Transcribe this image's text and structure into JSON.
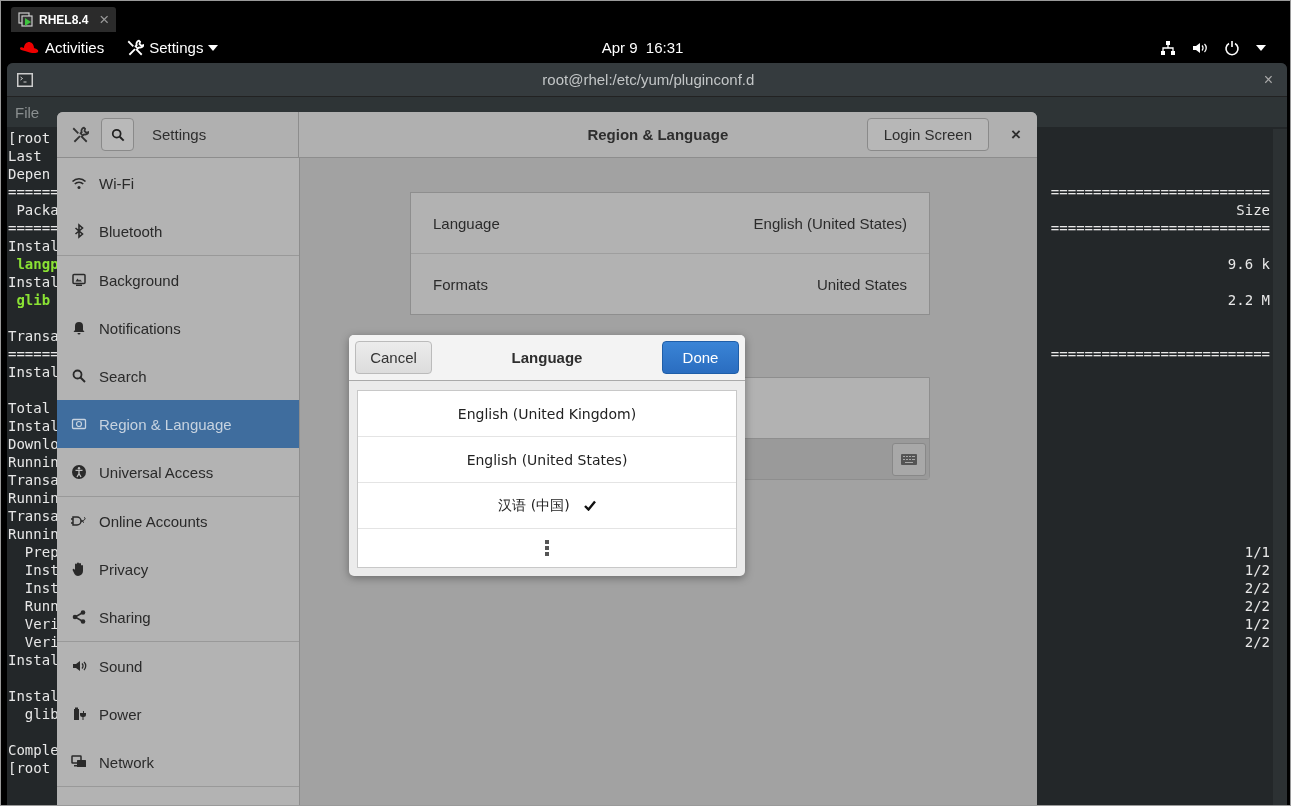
{
  "vm_tab": {
    "label": "RHEL8.4",
    "close": "×"
  },
  "top_bar": {
    "activities": "Activities",
    "app_menu": "Settings",
    "clock": "Apr 9  16:31"
  },
  "terminal": {
    "title": "root@rhel:/etc/yum/pluginconf.d",
    "close": "×",
    "menu": [
      "File"
    ],
    "rows": [
      {
        "kind": "plain",
        "left": "[root"
      },
      {
        "kind": "plain",
        "left": "Last"
      },
      {
        "kind": "plain",
        "left": "Depen"
      },
      {
        "kind": "plain",
        "left": "======",
        "right": "=========================="
      },
      {
        "kind": "plain",
        "left": " Packa",
        "right": "Size"
      },
      {
        "kind": "plain",
        "left": "======",
        "right": "=========================="
      },
      {
        "kind": "plain",
        "left": "Instal"
      },
      {
        "kind": "green",
        "left": " langp",
        "right": "9.6 k"
      },
      {
        "kind": "plain",
        "left": "Instal"
      },
      {
        "kind": "green",
        "left": " glib",
        "right": "2.2 M"
      },
      {
        "kind": "blank"
      },
      {
        "kind": "plain",
        "left": "Transa"
      },
      {
        "kind": "plain",
        "left": "======",
        "right": "=========================="
      },
      {
        "kind": "plain",
        "left": "Instal"
      },
      {
        "kind": "blank"
      },
      {
        "kind": "plain",
        "left": "Total"
      },
      {
        "kind": "plain",
        "left": "Instal"
      },
      {
        "kind": "plain",
        "left": "Downlo"
      },
      {
        "kind": "plain",
        "left": "Runnin"
      },
      {
        "kind": "plain",
        "left": "Transa"
      },
      {
        "kind": "plain",
        "left": "Runnin"
      },
      {
        "kind": "plain",
        "left": "Transa"
      },
      {
        "kind": "plain",
        "left": "Runnin"
      },
      {
        "kind": "plain",
        "left": "  Prep",
        "right": "1/1"
      },
      {
        "kind": "plain",
        "left": "  Inst",
        "right": "1/2"
      },
      {
        "kind": "plain",
        "left": "  Inst",
        "right": "2/2"
      },
      {
        "kind": "plain",
        "left": "  Runn",
        "right": "2/2"
      },
      {
        "kind": "plain",
        "left": "  Veri",
        "right": "1/2"
      },
      {
        "kind": "plain",
        "left": "  Veri",
        "right": "2/2"
      },
      {
        "kind": "plain",
        "left": "Instal"
      },
      {
        "kind": "blank"
      },
      {
        "kind": "plain",
        "left": "Instal"
      },
      {
        "kind": "plain",
        "left": "  glib"
      },
      {
        "kind": "blank"
      },
      {
        "kind": "plain",
        "left": "Comple"
      },
      {
        "kind": "plain",
        "left": "[root"
      }
    ]
  },
  "settings": {
    "title": "Settings",
    "panel_title": "Region & Language",
    "login_screen_button": "Login Screen",
    "close": "×",
    "sidebar": {
      "sections": [
        {
          "items": [
            {
              "label": "Wi-Fi",
              "selected": false
            },
            {
              "label": "Bluetooth",
              "selected": false
            }
          ]
        },
        {
          "items": [
            {
              "label": "Background",
              "selected": false
            },
            {
              "label": "Notifications",
              "selected": false
            },
            {
              "label": "Search",
              "selected": false
            },
            {
              "label": "Region & Language",
              "selected": true
            },
            {
              "label": "Universal Access",
              "selected": false
            }
          ]
        },
        {
          "items": [
            {
              "label": "Online Accounts",
              "selected": false
            },
            {
              "label": "Privacy",
              "selected": false
            },
            {
              "label": "Sharing",
              "selected": false
            }
          ]
        },
        {
          "items": [
            {
              "label": "Sound",
              "selected": false
            },
            {
              "label": "Power",
              "selected": false
            },
            {
              "label": "Network",
              "selected": false
            }
          ]
        }
      ]
    },
    "region": {
      "rows": [
        {
          "label": "Language",
          "value": "English (United States)"
        },
        {
          "label": "Formats",
          "value": "United States"
        }
      ]
    }
  },
  "language_dialog": {
    "title": "Language",
    "cancel": "Cancel",
    "done": "Done",
    "rows": [
      {
        "kind": "language",
        "label": "English (United Kingdom)",
        "selected": false
      },
      {
        "kind": "language",
        "label": "English (United States)",
        "selected": false
      },
      {
        "kind": "language",
        "label": "汉语 (中国)",
        "selected": true
      },
      {
        "kind": "more"
      }
    ]
  }
}
